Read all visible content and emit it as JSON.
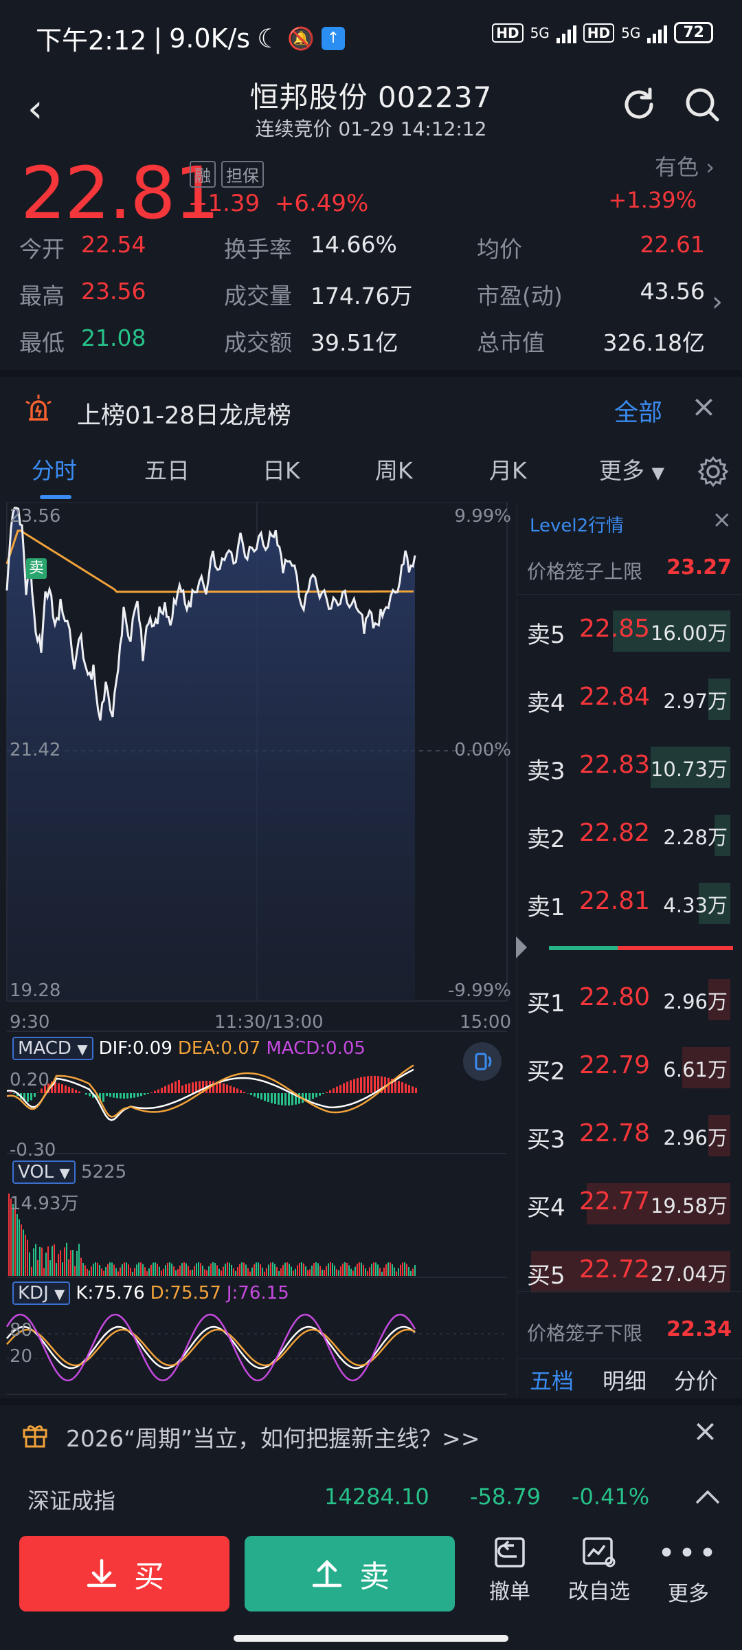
{
  "status": {
    "time": "下午2:12",
    "speed": "9.0K/s",
    "hd": "HD",
    "net": "5G",
    "battery": "72"
  },
  "header": {
    "title": "恒邦股份 002237",
    "subtitle": "连续竞价 01-29 14:12:12"
  },
  "quote": {
    "price": "22.81",
    "tag1": "融",
    "tag2": "担保",
    "change": "+1.39",
    "change_pct": "+6.49%",
    "sector_label": "有色",
    "sector_pct": "+1.39%",
    "rows": [
      [
        {
          "label": "今开",
          "value": "22.54",
          "color": "red"
        },
        {
          "label": "换手率",
          "value": "14.66%",
          "color": "white"
        },
        {
          "label": "均价",
          "value": "22.61",
          "color": "red"
        }
      ],
      [
        {
          "label": "最高",
          "value": "23.56",
          "color": "red"
        },
        {
          "label": "成交量",
          "value": "174.76万",
          "color": "white"
        },
        {
          "label": "市盈(动)",
          "value": "43.56",
          "color": "white"
        }
      ],
      [
        {
          "label": "最低",
          "value": "21.08",
          "color": "green"
        },
        {
          "label": "成交额",
          "value": "39.51亿",
          "color": "white"
        },
        {
          "label": "总市值",
          "value": "326.18亿",
          "color": "white"
        }
      ]
    ]
  },
  "notice": {
    "text": "上榜01-28日龙虎榜",
    "all": "全部"
  },
  "tabs": [
    "分时",
    "五日",
    "日K",
    "周K",
    "月K",
    "更多"
  ],
  "chart": {
    "y_top": "23.56",
    "y_mid": "21.42",
    "y_bottom": "19.28",
    "pct_top": "9.99%",
    "pct_mid": "0.00%",
    "pct_bottom": "-9.99%",
    "x_start": "9:30",
    "x_mid": "11:30/13:00",
    "x_end": "15:00",
    "sell_marker": "卖",
    "macd": {
      "name": "MACD",
      "dif": "DIF:0.09",
      "dea": "DEA:0.07",
      "macd": "MACD:0.05",
      "top": "0.20",
      "bottom": "-0.30"
    },
    "vol": {
      "name": "VOL",
      "value": "5225",
      "max": "14.93万"
    },
    "kdj": {
      "name": "KDJ",
      "k": "K:75.76",
      "d": "D:75.57",
      "j": "J:76.15",
      "l1": "80",
      "l2": "20"
    }
  },
  "book": {
    "title": "Level2行情",
    "upper_label": "价格笼子上限",
    "upper": "23.27",
    "lower_label": "价格笼子下限",
    "lower": "22.34",
    "asks": [
      {
        "label": "卖5",
        "price": "22.85",
        "vol": "16.00万",
        "frac": 0.59
      },
      {
        "label": "卖4",
        "price": "22.84",
        "vol": "2.97万",
        "frac": 0.11
      },
      {
        "label": "卖3",
        "price": "22.83",
        "vol": "10.73万",
        "frac": 0.4
      },
      {
        "label": "卖2",
        "price": "22.82",
        "vol": "2.28万",
        "frac": 0.08
      },
      {
        "label": "卖1",
        "price": "22.81",
        "vol": "4.33万",
        "frac": 0.16
      }
    ],
    "bids": [
      {
        "label": "买1",
        "price": "22.80",
        "vol": "2.96万",
        "frac": 0.11
      },
      {
        "label": "买2",
        "price": "22.79",
        "vol": "6.61万",
        "frac": 0.24
      },
      {
        "label": "买3",
        "price": "22.78",
        "vol": "2.96万",
        "frac": 0.11
      },
      {
        "label": "买4",
        "price": "22.77",
        "vol": "19.58万",
        "frac": 0.72
      },
      {
        "label": "买5",
        "price": "22.72",
        "vol": "27.04万",
        "frac": 1.0
      }
    ],
    "tabs": [
      "五档",
      "明细",
      "分价"
    ]
  },
  "promo": {
    "text": "2026“周期”当立，如何把握新主线？>>"
  },
  "index": {
    "name": "深证成指",
    "value": "14284.10",
    "change": "-58.79",
    "pct": "-0.41%"
  },
  "actions": {
    "buy": "买",
    "sell": "卖",
    "cancel": "撤单",
    "edit": "改自选",
    "more": "更多"
  },
  "colors": {
    "up": "#f5363b",
    "down": "#27c18a",
    "accent": "#3b8cf2",
    "avg": "#f2a33a"
  }
}
